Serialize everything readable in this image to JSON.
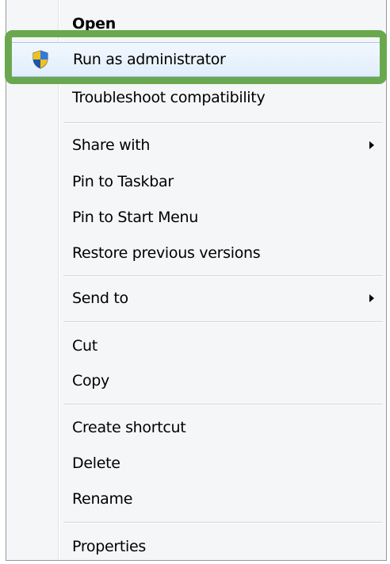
{
  "context_menu": {
    "items": [
      {
        "label": "Open"
      },
      {
        "label": "Run as administrator",
        "icon": "uac-shield-icon"
      },
      {
        "label": "Troubleshoot compatibility"
      },
      {
        "label": "Share with",
        "submenu": true
      },
      {
        "label": "Pin to Taskbar"
      },
      {
        "label": "Pin to Start Menu"
      },
      {
        "label": "Restore previous versions"
      },
      {
        "label": "Send to",
        "submenu": true
      },
      {
        "label": "Cut"
      },
      {
        "label": "Copy"
      },
      {
        "label": "Create shortcut"
      },
      {
        "label": "Delete"
      },
      {
        "label": "Rename"
      },
      {
        "label": "Properties"
      }
    ],
    "hovered_item": "Run as administrator"
  },
  "highlight": {
    "color": "#6aa84f",
    "target": "Run as administrator"
  },
  "colors": {
    "menu_background": "#f5f6f7",
    "hover_border": "#a8c8eb",
    "shield_blue": "#1d64c4",
    "shield_yellow": "#f2c21a"
  }
}
